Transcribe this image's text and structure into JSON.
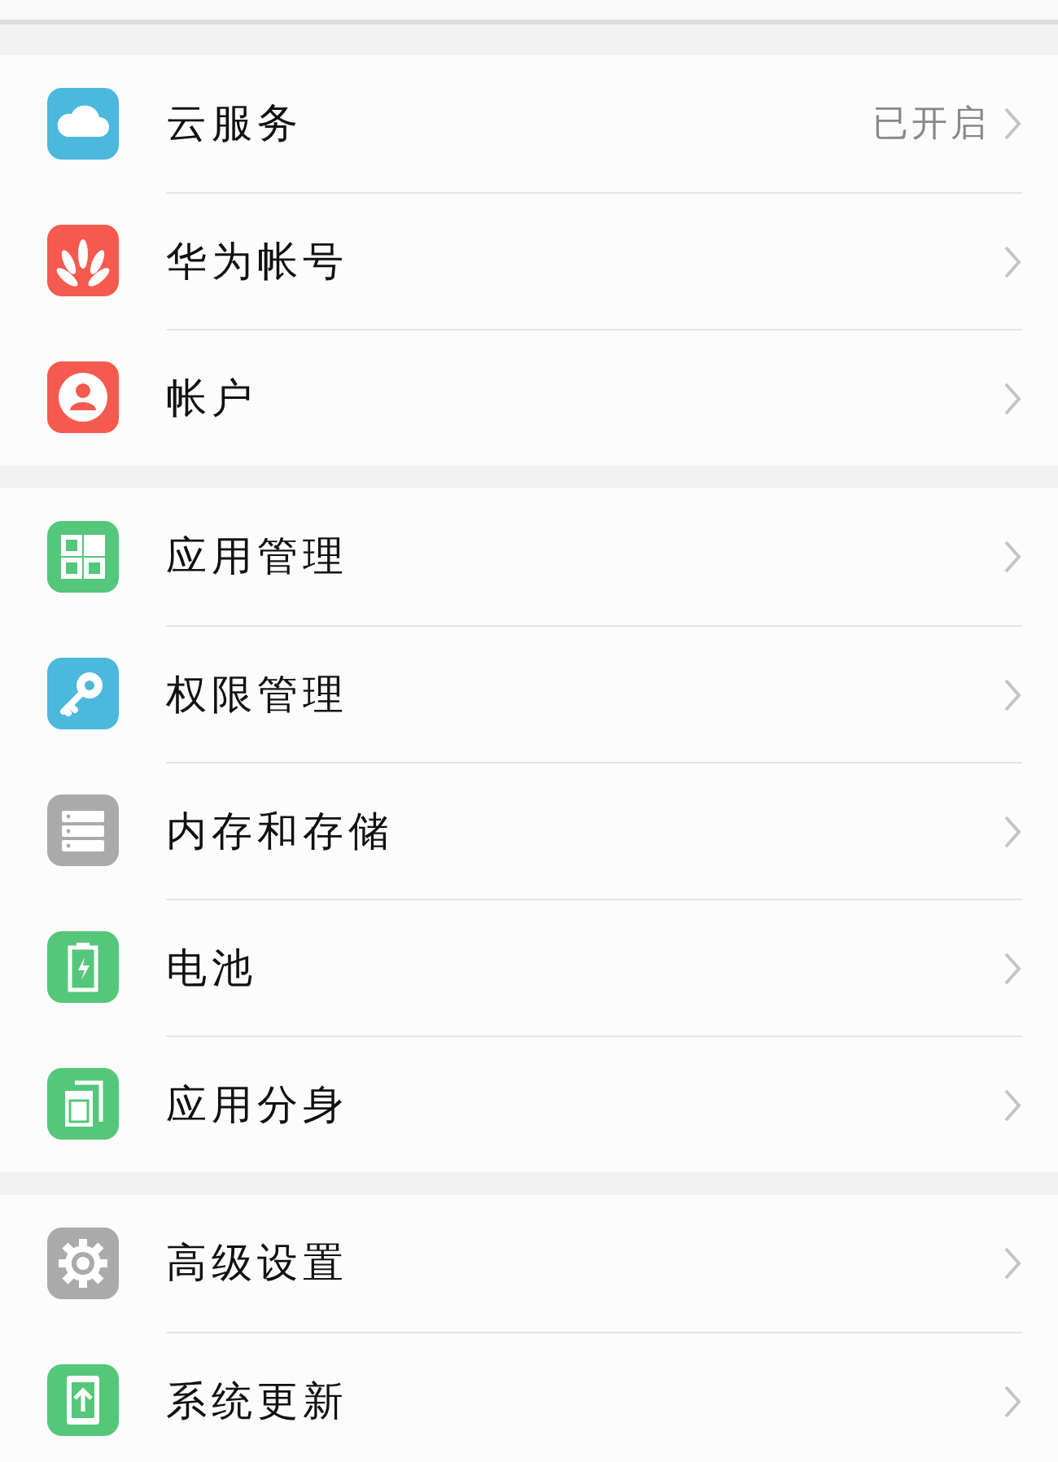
{
  "sections": [
    {
      "items": [
        {
          "kind": "cloud",
          "color": "#4cb8dc",
          "label": "云服务",
          "value": "已开启"
        },
        {
          "kind": "petals",
          "color": "#f45b4e",
          "label": "华为帐号"
        },
        {
          "kind": "person",
          "color": "#f45b4e",
          "label": "帐户"
        }
      ]
    },
    {
      "items": [
        {
          "kind": "grid",
          "color": "#55c77a",
          "label": "应用管理"
        },
        {
          "kind": "key",
          "color": "#4cb8dc",
          "label": "权限管理"
        },
        {
          "kind": "storage",
          "color": "#aaaaaa",
          "label": "内存和存储"
        },
        {
          "kind": "battery",
          "color": "#55c77a",
          "label": "电池"
        },
        {
          "kind": "clone",
          "color": "#55c77a",
          "label": "应用分身"
        }
      ]
    },
    {
      "items": [
        {
          "kind": "gear",
          "color": "#aaaaaa",
          "label": "高级设置"
        },
        {
          "kind": "update",
          "color": "#55c77a",
          "label": "系统更新"
        }
      ]
    }
  ]
}
